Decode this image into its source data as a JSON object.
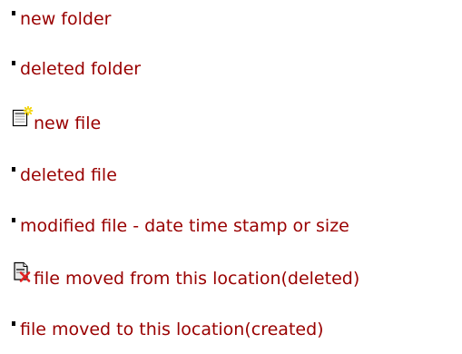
{
  "legend": {
    "items": [
      {
        "label": "new folder",
        "marker": "bullet"
      },
      {
        "label": "deleted folder",
        "marker": "bullet"
      },
      {
        "label": "new file",
        "marker": "new-file-icon"
      },
      {
        "label": "deleted file",
        "marker": "bullet"
      },
      {
        "label": "modified file - date time stamp or size",
        "marker": "bullet"
      },
      {
        "label": "file moved from this location(deleted)",
        "marker": "file-moved-from-icon"
      },
      {
        "label": "file moved to this location(created)",
        "marker": "bullet"
      }
    ]
  },
  "colors": {
    "link_text": "#990000",
    "bullet": "#000000",
    "background": "#ffffff"
  }
}
